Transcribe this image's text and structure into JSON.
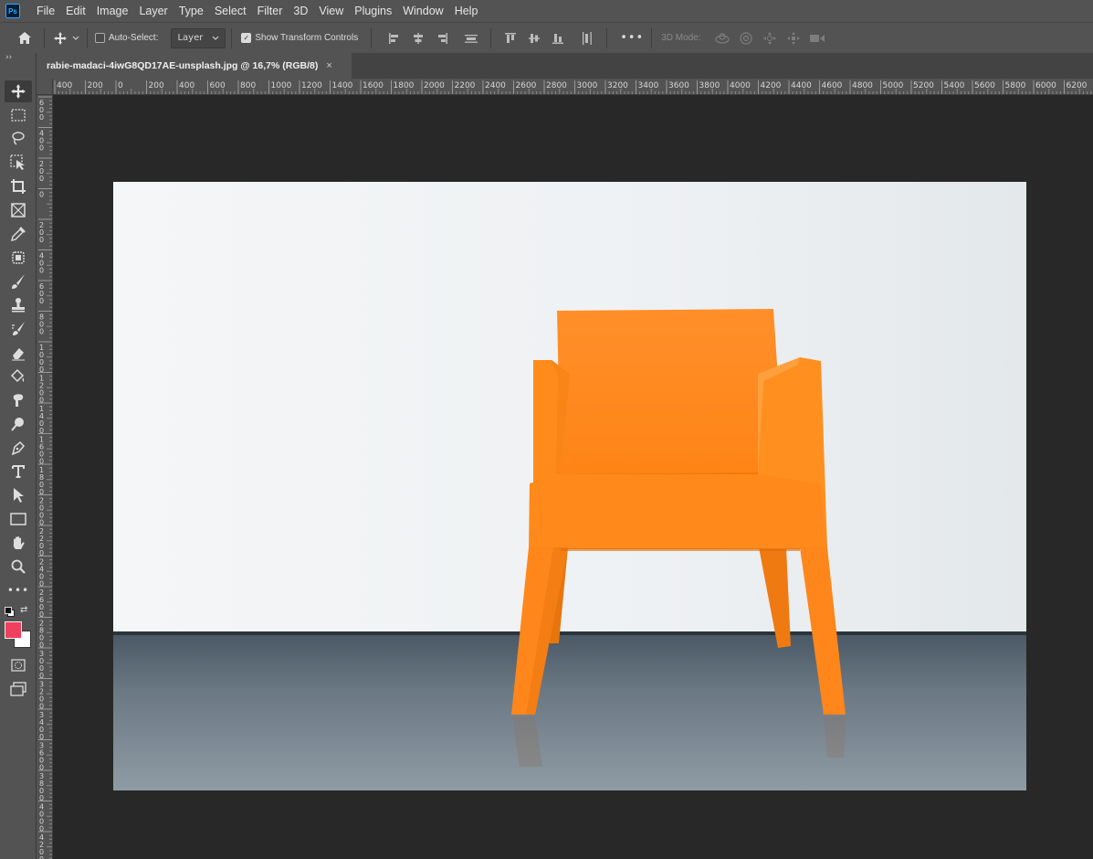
{
  "app": {
    "logo_text": "Ps",
    "menu": [
      "File",
      "Edit",
      "Image",
      "Layer",
      "Type",
      "Select",
      "Filter",
      "3D",
      "View",
      "Plugins",
      "Window",
      "Help"
    ]
  },
  "options": {
    "auto_select_label": "Auto-Select:",
    "auto_select_checked": false,
    "layer_dropdown": "Layer",
    "show_transform_label": "Show Transform Controls",
    "show_transform_checked": true,
    "more_label": "•••",
    "mode_3d_label": "3D Mode:"
  },
  "document": {
    "tab_title": "rabie-madaci-4iwG8QD17AE-unsplash.jpg @ 16,7% (RGB/8)",
    "close_glyph": "×"
  },
  "ruler": {
    "h_labels": [
      "400",
      "200",
      "0",
      "200",
      "400",
      "600",
      "800",
      "1000",
      "1200",
      "1400",
      "1600",
      "1800",
      "2000",
      "2200",
      "2400",
      "2600",
      "2800",
      "3000",
      "3200",
      "3400",
      "3600",
      "3800",
      "4000",
      "4200",
      "4400",
      "4600",
      "4800",
      "5000",
      "5200",
      "5400",
      "5600",
      "5800",
      "6000",
      "6200"
    ],
    "v_labels": [
      "6 0 0",
      "4 0 0",
      "2 0 0",
      "0",
      "2 0 0",
      "4 0 0",
      "6 0 0",
      "8 0 0",
      "1 0 0 0",
      "1 2 0 0",
      "1 4 0 0",
      "1 6 0 0",
      "1 8 0 0",
      "2 0 0 0",
      "2 2 0 0",
      "2 4 0 0",
      "2 6 0 0",
      "2 8 0 0",
      "3 0 0 0",
      "3 2 0 0",
      "3 4 0 0",
      "3 6 0 0",
      "3 8 0 0",
      "4 0 0 0",
      "4 2 0 0"
    ]
  },
  "tools": {
    "more_label": "•••",
    "foreground_color": "#f0405f",
    "background_color": "#ffffff"
  },
  "colors": {
    "chair": "#ff8a1e",
    "wall": "#eef1f3",
    "floor": "#6d7b86"
  }
}
